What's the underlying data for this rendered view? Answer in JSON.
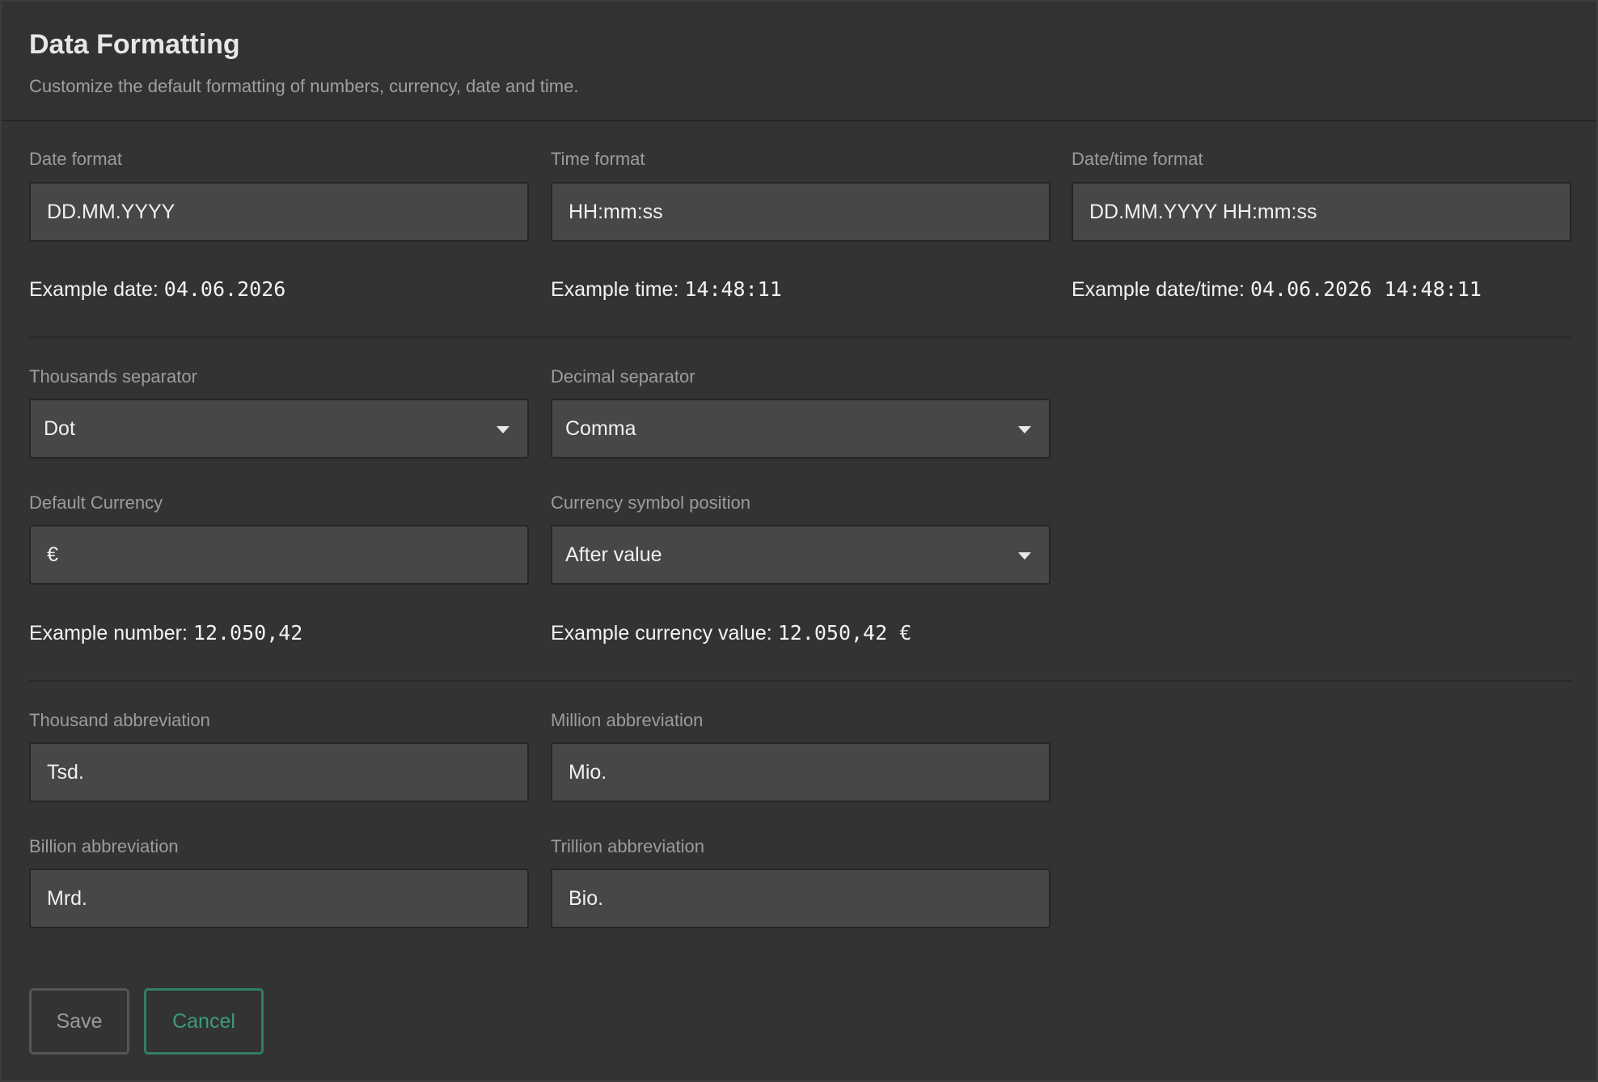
{
  "header": {
    "title": "Data Formatting",
    "subtitle": "Customize the default formatting of numbers, currency, date and time."
  },
  "date_time": {
    "date_format": {
      "label": "Date format",
      "value": "DD.MM.YYYY"
    },
    "time_format": {
      "label": "Time format",
      "value": "HH:mm:ss"
    },
    "datetime_format": {
      "label": "Date/time format",
      "value": "DD.MM.YYYY HH:mm:ss"
    },
    "examples": {
      "date_label": "Example date:",
      "date_value": "04.06.2026",
      "time_label": "Example time:",
      "time_value": "14:48:11",
      "datetime_label": "Example date/time:",
      "datetime_value": "04.06.2026 14:48:11"
    }
  },
  "numbers": {
    "thousands_separator": {
      "label": "Thousands separator",
      "value": "Dot"
    },
    "decimal_separator": {
      "label": "Decimal separator",
      "value": "Comma"
    },
    "default_currency": {
      "label": "Default Currency",
      "value": "€"
    },
    "currency_position": {
      "label": "Currency symbol position",
      "value": "After value"
    },
    "examples": {
      "number_label": "Example number:",
      "number_value": "12.050,42",
      "currency_label": "Example currency value:",
      "currency_value": "12.050,42 €"
    }
  },
  "abbreviations": {
    "thousand": {
      "label": "Thousand abbreviation",
      "value": "Tsd."
    },
    "million": {
      "label": "Million abbreviation",
      "value": "Mio."
    },
    "billion": {
      "label": "Billion abbreviation",
      "value": "Mrd."
    },
    "trillion": {
      "label": "Trillion abbreviation",
      "value": "Bio."
    }
  },
  "actions": {
    "save_label": "Save",
    "cancel_label": "Cancel"
  },
  "colors": {
    "background": "#333333",
    "input_background": "#474747",
    "accent": "#3a9b7c"
  },
  "icons": {
    "dropdown": "caret-down-icon"
  }
}
